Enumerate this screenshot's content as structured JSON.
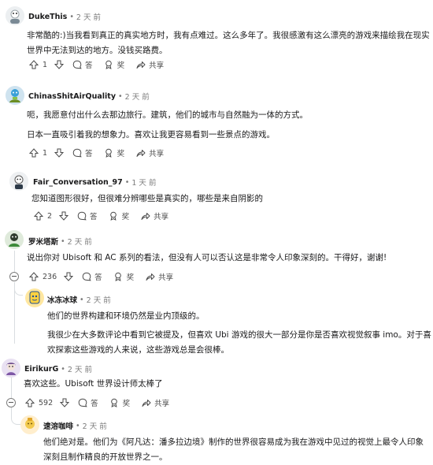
{
  "labels": {
    "reply": "答",
    "award": "奖",
    "share": "共享"
  },
  "comments": [
    {
      "author": "DukeThis",
      "time": "2 天 前",
      "lines": [
        "非常酷的:)当我看到真正的真实地方时，我有点难过。这么多年了。我很感激有这么漂亮的游戏来描绘我在现实",
        "世界中无法到达的地方。没钱买路费。"
      ],
      "votes": "1"
    },
    {
      "author": "ChinasShitAirQuality",
      "time": "2 天 前",
      "lines": [
        "呃，我愿意付出什么去那边旅行。建筑，他们的城市与自然融为一体的方式。",
        "日本一直吸引着我的想象力。喜欢让我更容易看到一些景点的游戏。"
      ],
      "votes": "1"
    },
    {
      "author": "Fair_Conversation_97",
      "time": "1 天 前",
      "lines": [
        "您知道图形很好，但很难分辨哪些是真实的，哪些是来自阴影的"
      ],
      "votes": "2"
    },
    {
      "author": "罗米塔斯",
      "time": "2 天 前",
      "lines": [
        "说出你对 Ubisoft 和 AC 系列的看法，但没有人可以否认这是非常令人印象深刻的。干得好，谢谢!"
      ],
      "votes": "236"
    },
    {
      "author": "冰冻冰球",
      "time": "2 天 前",
      "lines": [
        "他们的世界构建和环境仍然是业内顶级的。",
        "我很少在大多数评论中看到它被提及，但喜欢 Ubi 游戏的很大一部分是你是否喜欢视觉叙事 imo。对于喜",
        "欢探索这些游戏的人来说，这些游戏总是会很棒。"
      ]
    },
    {
      "author": "EirikurG",
      "time": "2 天 前",
      "lines": [
        "喜欢这些。Ubisoft 世界设计师太棒了"
      ],
      "votes": "592"
    },
    {
      "author": "速溶咖啡",
      "time": "2 天 前",
      "lines": [
        "他们绝对是。他们为《阿凡达：潘多拉边境》制作的世界很容易成为我在游戏中见过的视觉上最令人印象",
        "深刻且制作精良的开放世界之一。"
      ]
    }
  ]
}
